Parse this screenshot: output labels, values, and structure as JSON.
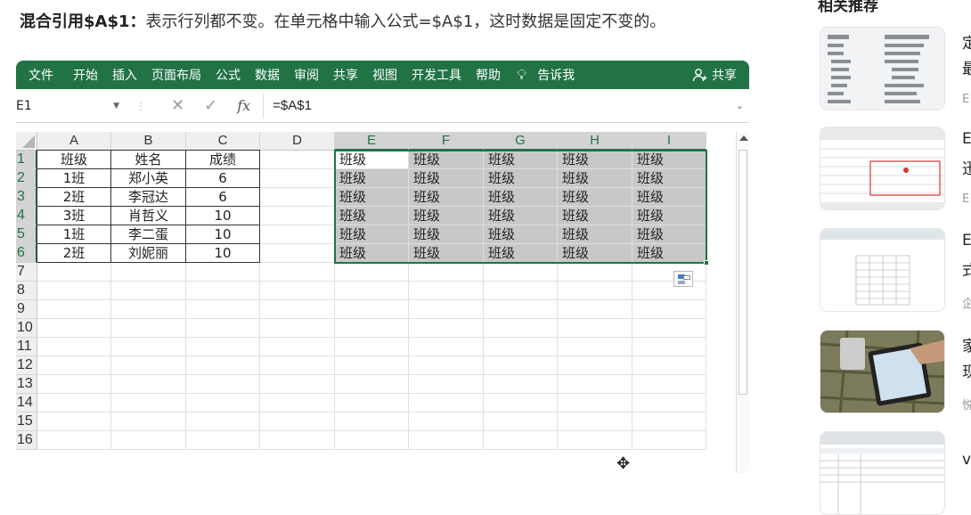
{
  "heading": {
    "strong": "混合引用$A$1：",
    "text": "表示行列都不变。在单元格中输入公式=$A$1，这时数据是固定不变的。"
  },
  "ribbon": {
    "tabs": [
      "文件",
      "开始",
      "插入",
      "页面布局",
      "公式",
      "数据",
      "审阅",
      "共享",
      "视图",
      "开发工具",
      "帮助"
    ],
    "tell_me": "告诉我",
    "share": "共享"
  },
  "formula_bar": {
    "name_box": "E1",
    "formula": "=$A$1"
  },
  "sheet": {
    "columns": [
      "A",
      "B",
      "C",
      "D",
      "E",
      "F",
      "G",
      "H",
      "I"
    ],
    "rows": [
      "1",
      "2",
      "3",
      "4",
      "5",
      "6",
      "7",
      "8",
      "9",
      "10",
      "11",
      "12",
      "13",
      "14",
      "15",
      "16"
    ],
    "table_abc": [
      [
        "班级",
        "姓名",
        "成绩"
      ],
      [
        "1班",
        "郑小英",
        "6"
      ],
      [
        "2班",
        "李冠达",
        "6"
      ],
      [
        "3班",
        "肖哲义",
        "10"
      ],
      [
        "1班",
        "李二蛋",
        "10"
      ],
      [
        "2班",
        "刘妮丽",
        "10"
      ]
    ],
    "range_ei_value": "班级"
  },
  "sidebar": {
    "title": "相关推荐",
    "items": [
      {
        "line1": "定",
        "line2": "最",
        "sub": "E"
      },
      {
        "line1": "E",
        "line2": "迅",
        "sub": "E"
      },
      {
        "line1": "E",
        "line2": "式",
        "sub": "企"
      },
      {
        "line1": "家",
        "line2": "现",
        "sub": "悦"
      },
      {
        "line1": "v",
        "line2": "",
        "sub": ""
      }
    ]
  },
  "colors": {
    "ribbon": "#217346",
    "selection": "#217346",
    "shaded": "#c8c8c8"
  }
}
